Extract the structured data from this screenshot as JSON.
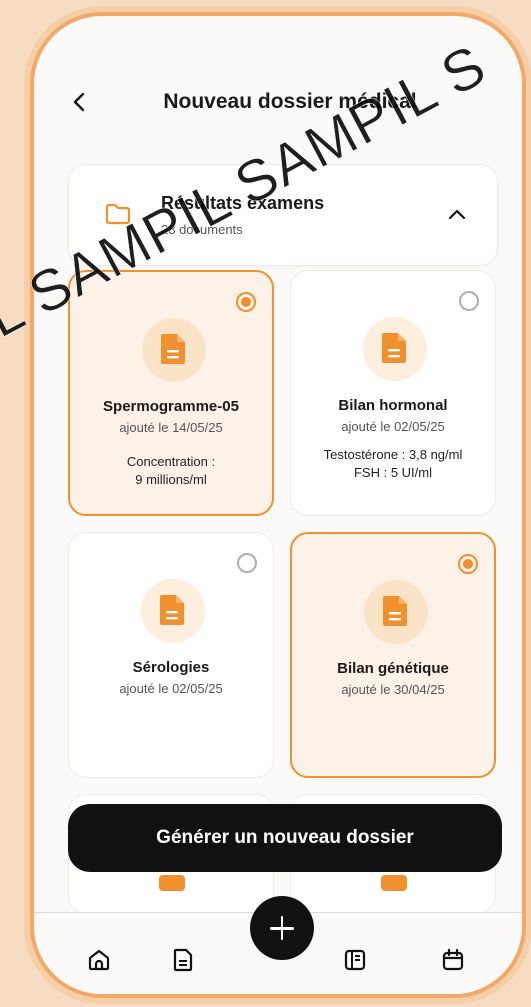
{
  "header": {
    "title": "Nouveau dossier médical"
  },
  "folder": {
    "name": "Résultats examens",
    "count": "28 documents"
  },
  "cards": [
    {
      "title": "Spermogramme-05",
      "date": "ajouté le 14/05/25",
      "detail1": "Concentration :",
      "detail2": "9 millions/ml",
      "selected": true
    },
    {
      "title": "Bilan hormonal",
      "date": "ajouté le 02/05/25",
      "detail1": "Testostérone : 3,8 ng/ml",
      "detail2": "FSH : 5 UI/ml",
      "selected": false
    },
    {
      "title": "Sérologies",
      "date": "ajouté le 02/05/25",
      "detail1": "",
      "detail2": "",
      "selected": false
    },
    {
      "title": "Bilan génétique",
      "date": "ajouté le 30/04/25",
      "detail1": "",
      "detail2": "",
      "selected": true
    }
  ],
  "action": {
    "generate_label": "Générer un nouveau dossier"
  },
  "nav": {
    "items": [
      {
        "icon": "home-icon"
      },
      {
        "icon": "document-icon"
      },
      {
        "icon": "plus-icon"
      },
      {
        "icon": "journal-icon"
      },
      {
        "icon": "calendar-icon"
      }
    ]
  },
  "watermark": "IL SAMPIL SAMPIL S",
  "colors": {
    "accent": "#f0902e",
    "dark": "#111111",
    "frame": "#f2a867",
    "background": "#fbfaf8"
  }
}
